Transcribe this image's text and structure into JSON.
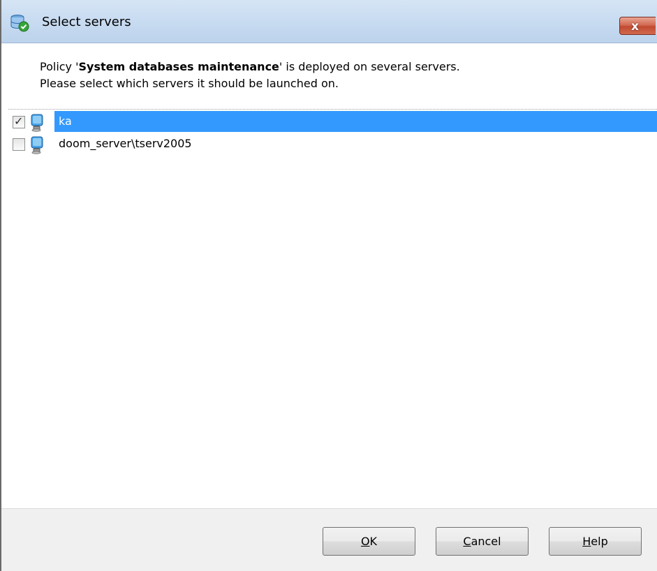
{
  "window": {
    "title": "Select servers",
    "close_label": "x"
  },
  "message": {
    "line1_prefix": "Policy '",
    "policy_name": "System databases maintenance",
    "line1_suffix": "' is deployed on several servers.",
    "line2": "Please select which servers it should be launched on."
  },
  "servers": [
    {
      "name": "ka",
      "checked": true,
      "selected": true
    },
    {
      "name": "doom_server\\tserv2005",
      "checked": false,
      "selected": false
    }
  ],
  "buttons": {
    "ok": {
      "accel": "O",
      "rest": "K"
    },
    "cancel": {
      "accel": "C",
      "rest": "ancel"
    },
    "help": {
      "accel": "H",
      "rest": "elp"
    }
  },
  "colors": {
    "selection": "#3399ff",
    "titlebar": "#c9dcf1",
    "close_button": "#c04a31"
  },
  "icons": {
    "title": "database-check-icon",
    "server": "server-computer-icon"
  }
}
